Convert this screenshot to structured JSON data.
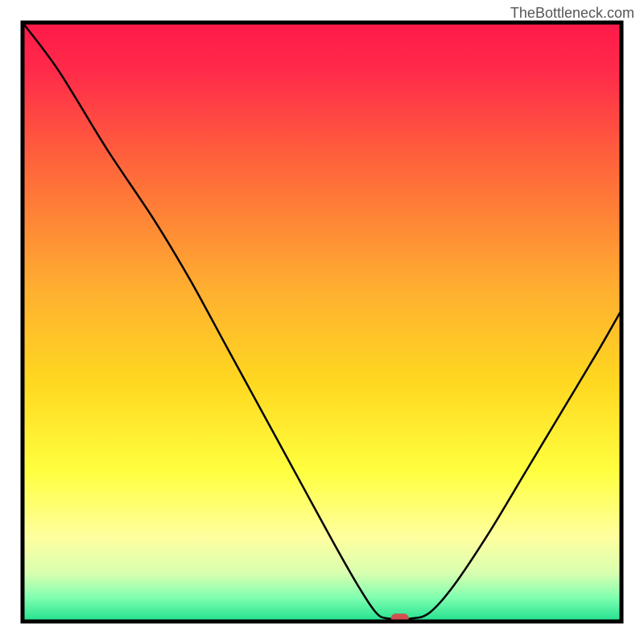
{
  "watermark": "TheBottleneck.com",
  "chart_data": {
    "type": "line",
    "title": "",
    "xlabel": "",
    "ylabel": "",
    "xlim": [
      0,
      100
    ],
    "ylim": [
      0,
      100
    ],
    "background": {
      "type": "vertical-gradient",
      "stops": [
        {
          "offset": 0.0,
          "color": "#ff1a4a"
        },
        {
          "offset": 0.08,
          "color": "#ff2a4a"
        },
        {
          "offset": 0.25,
          "color": "#ff6a3a"
        },
        {
          "offset": 0.45,
          "color": "#ffb030"
        },
        {
          "offset": 0.6,
          "color": "#ffd820"
        },
        {
          "offset": 0.75,
          "color": "#ffff40"
        },
        {
          "offset": 0.86,
          "color": "#ffffa0"
        },
        {
          "offset": 0.92,
          "color": "#d8ffb0"
        },
        {
          "offset": 0.96,
          "color": "#80ffb0"
        },
        {
          "offset": 1.0,
          "color": "#20e090"
        }
      ]
    },
    "curve": {
      "description": "Bottleneck curve: high at left, drops steeply to near-zero around x≈62, flat minimum, rises toward right edge",
      "points": [
        {
          "x": 0,
          "y": 100
        },
        {
          "x": 6,
          "y": 92
        },
        {
          "x": 14,
          "y": 79
        },
        {
          "x": 22,
          "y": 67
        },
        {
          "x": 28,
          "y": 57
        },
        {
          "x": 34,
          "y": 46
        },
        {
          "x": 40,
          "y": 35
        },
        {
          "x": 46,
          "y": 24
        },
        {
          "x": 52,
          "y": 13
        },
        {
          "x": 56,
          "y": 6
        },
        {
          "x": 59,
          "y": 1.5
        },
        {
          "x": 61,
          "y": 0.5
        },
        {
          "x": 65,
          "y": 0.5
        },
        {
          "x": 68,
          "y": 1.5
        },
        {
          "x": 72,
          "y": 6
        },
        {
          "x": 78,
          "y": 15
        },
        {
          "x": 84,
          "y": 25
        },
        {
          "x": 90,
          "y": 35
        },
        {
          "x": 96,
          "y": 45
        },
        {
          "x": 100,
          "y": 52
        }
      ]
    },
    "marker": {
      "x": 63,
      "y": 0.5,
      "color": "#d05050",
      "shape": "rounded-rect"
    },
    "frame": {
      "stroke": "#000000",
      "strokeWidth": 5
    }
  }
}
